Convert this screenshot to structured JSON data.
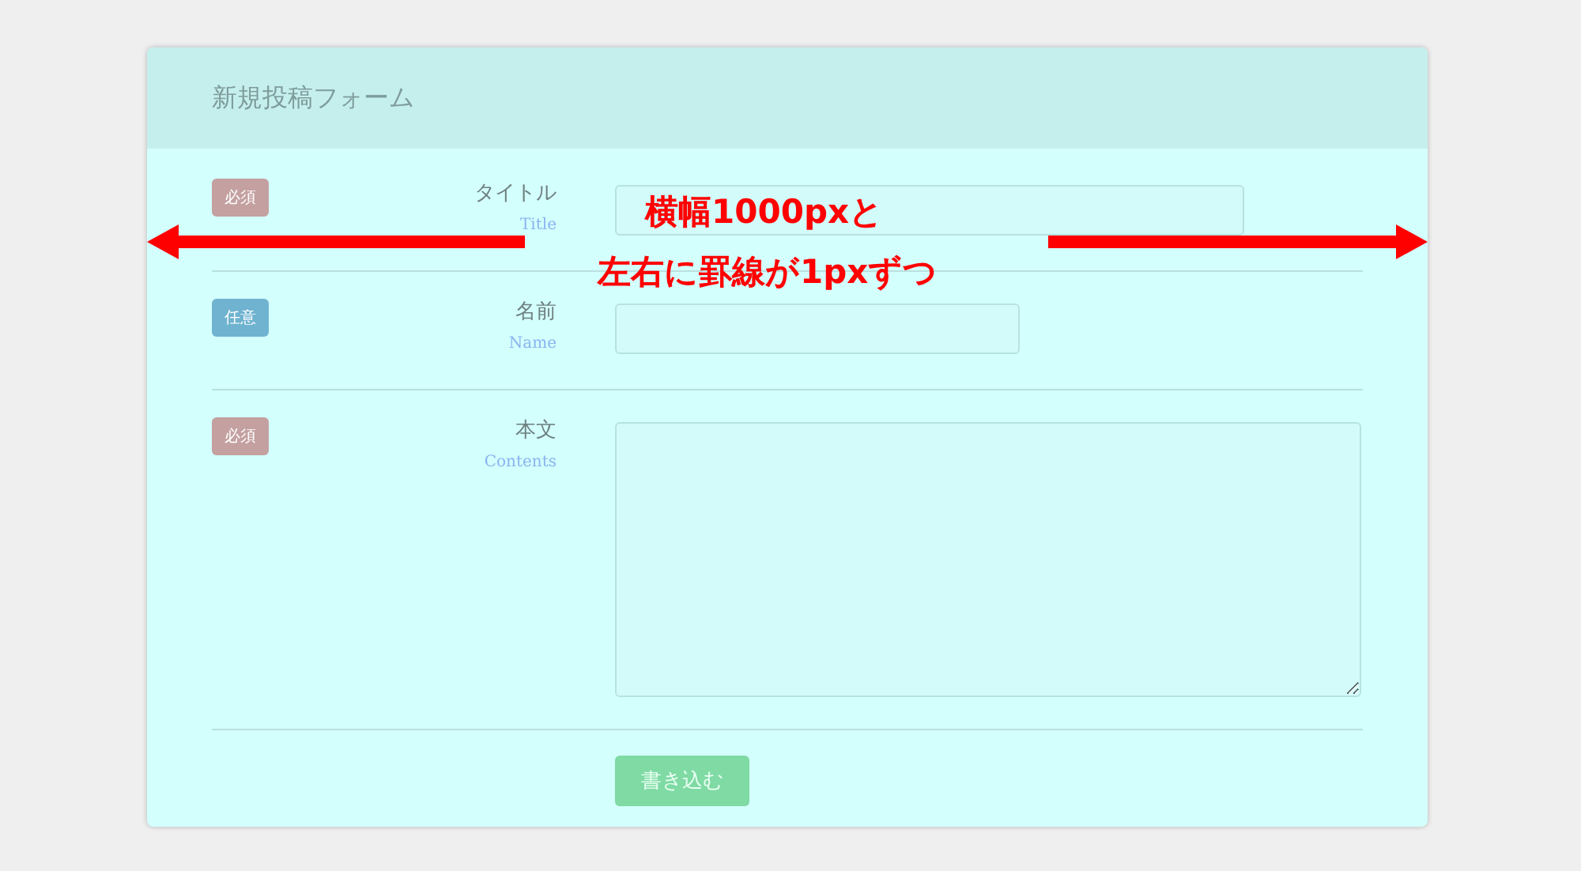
{
  "form": {
    "title": "新規投稿フォーム",
    "fields": [
      {
        "badge": {
          "label": "必須",
          "color": "#c4a0a0"
        },
        "label": "タイトル",
        "sublabel": "Title",
        "kind": "text"
      },
      {
        "badge": {
          "label": "任意",
          "color": "#6fb3d0"
        },
        "label": "名前",
        "sublabel": "Name",
        "kind": "text"
      },
      {
        "badge": {
          "label": "必須",
          "color": "#c4a0a0"
        },
        "label": "本文",
        "sublabel": "Contents",
        "kind": "textarea"
      }
    ],
    "submit": "書き込む"
  },
  "annotation": {
    "lines": [
      "横幅1000pxと",
      "左右に罫線が1pxずつ"
    ]
  }
}
